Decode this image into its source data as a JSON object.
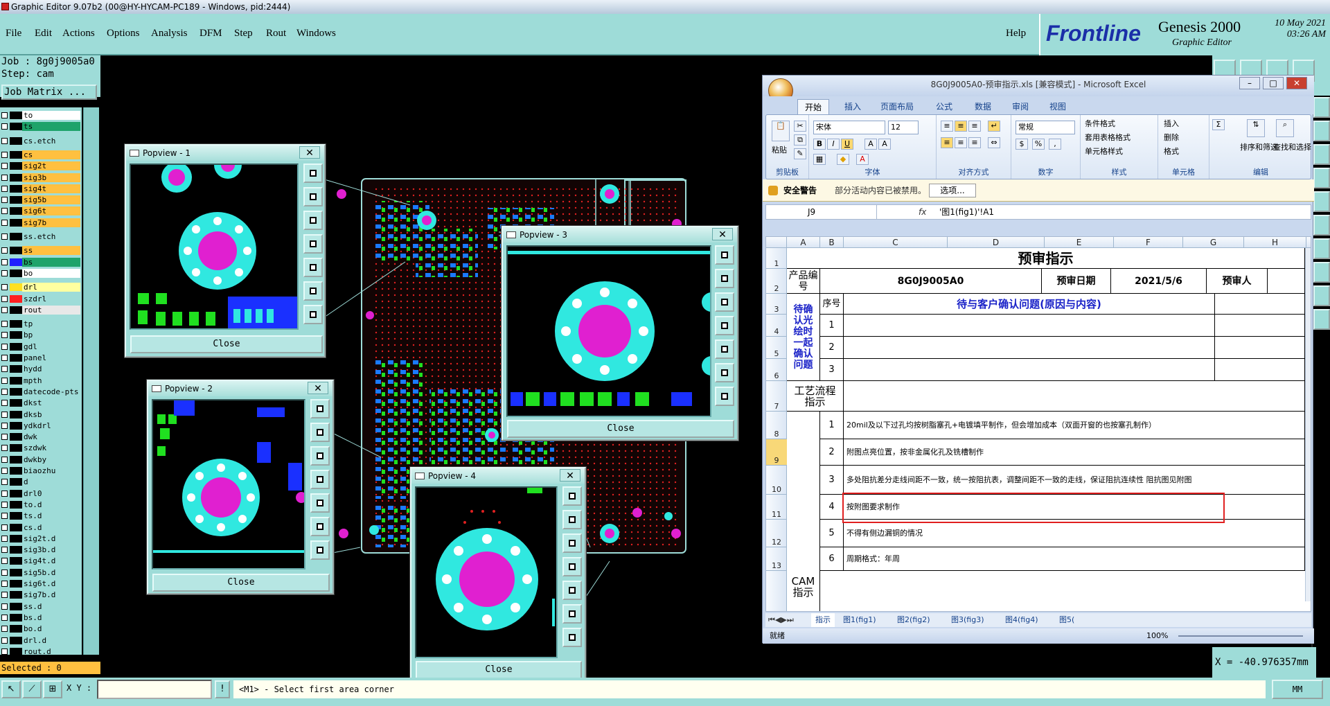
{
  "window": {
    "title": "Graphic Editor 9.07b2 (00@HY-HYCAM-PC189 - Windows, pid:2444)"
  },
  "menu": {
    "items": [
      "File",
      "Edit",
      "Actions",
      "Options",
      "Analysis",
      "DFM",
      "Step",
      "Rout",
      "Windows"
    ],
    "help": "Help"
  },
  "brand": {
    "logo": "Frontline",
    "product": "Genesis 2000",
    "subtitle": "Graphic Editor",
    "date": "10 May 2021",
    "time": "03:26 AM"
  },
  "job": {
    "job_line": "Job : 8g0j9005a0",
    "step_line": "Step: cam",
    "matrix_button": "Job Matrix ..."
  },
  "layers": [
    {
      "name": "to",
      "color": "#ffffff",
      "swatch": "#000000"
    },
    {
      "name": "ts",
      "color": "#1ea36a",
      "swatch": "#000000"
    },
    {
      "name": "cs.etch",
      "color": "#9edcd8",
      "swatch": "#000000"
    },
    {
      "name": "cs",
      "color": "#ffc040",
      "swatch": "#000000"
    },
    {
      "name": "sig2t",
      "color": "#ffc040",
      "swatch": "#000000"
    },
    {
      "name": "sig3b",
      "color": "#ffc040",
      "swatch": "#000000"
    },
    {
      "name": "sig4t",
      "color": "#ffc040",
      "swatch": "#000000"
    },
    {
      "name": "sig5b",
      "color": "#ffc040",
      "swatch": "#000000"
    },
    {
      "name": "sig6t",
      "color": "#ffc040",
      "swatch": "#000000"
    },
    {
      "name": "sig7b",
      "color": "#ffc040",
      "swatch": "#000000"
    },
    {
      "name": "ss.etch",
      "color": "#9edcd8",
      "swatch": "#000000"
    },
    {
      "name": "ss",
      "color": "#ffc040",
      "swatch": "#000000"
    },
    {
      "name": "bs",
      "color": "#1ea36a",
      "swatch": "#2020ff"
    },
    {
      "name": "bo",
      "color": "#ffffff",
      "swatch": "#000000"
    },
    {
      "name": "drl",
      "color": "#ffffa0",
      "swatch": "#ffe020"
    },
    {
      "name": "szdrl",
      "color": "#9edcd8",
      "swatch": "#ff2020"
    },
    {
      "name": "rout",
      "color": "#e8e8e8",
      "swatch": "#000000"
    },
    {
      "name": "tp",
      "color": "#9edcd8",
      "swatch": "#000000"
    },
    {
      "name": "bp",
      "color": "#9edcd8",
      "swatch": "#000000"
    },
    {
      "name": "gdl",
      "color": "#9edcd8",
      "swatch": "#000000"
    },
    {
      "name": "panel",
      "color": "#9edcd8",
      "swatch": "#000000"
    },
    {
      "name": "hydd",
      "color": "#9edcd8",
      "swatch": "#000000"
    },
    {
      "name": "mpth",
      "color": "#9edcd8",
      "swatch": "#000000"
    },
    {
      "name": "datecode-pts",
      "color": "#9edcd8",
      "swatch": "#000000"
    },
    {
      "name": "dkst",
      "color": "#9edcd8",
      "swatch": "#000000"
    },
    {
      "name": "dksb",
      "color": "#9edcd8",
      "swatch": "#000000"
    },
    {
      "name": "ydkdrl",
      "color": "#9edcd8",
      "swatch": "#000000"
    },
    {
      "name": "dwk",
      "color": "#9edcd8",
      "swatch": "#000000"
    },
    {
      "name": "szdwk",
      "color": "#9edcd8",
      "swatch": "#000000"
    },
    {
      "name": "dwkby",
      "color": "#9edcd8",
      "swatch": "#000000"
    },
    {
      "name": "biaozhu",
      "color": "#9edcd8",
      "swatch": "#000000"
    },
    {
      "name": "d",
      "color": "#9edcd8",
      "swatch": "#000000"
    },
    {
      "name": "drl0",
      "color": "#9edcd8",
      "swatch": "#000000"
    },
    {
      "name": "to.d",
      "color": "#9edcd8",
      "swatch": "#000000"
    },
    {
      "name": "ts.d",
      "color": "#9edcd8",
      "swatch": "#000000"
    },
    {
      "name": "cs.d",
      "color": "#9edcd8",
      "swatch": "#000000"
    },
    {
      "name": "sig2t.d",
      "color": "#9edcd8",
      "swatch": "#000000"
    },
    {
      "name": "sig3b.d",
      "color": "#9edcd8",
      "swatch": "#000000"
    },
    {
      "name": "sig4t.d",
      "color": "#9edcd8",
      "swatch": "#000000"
    },
    {
      "name": "sig5b.d",
      "color": "#9edcd8",
      "swatch": "#000000"
    },
    {
      "name": "sig6t.d",
      "color": "#9edcd8",
      "swatch": "#000000"
    },
    {
      "name": "sig7b.d",
      "color": "#9edcd8",
      "swatch": "#000000"
    },
    {
      "name": "ss.d",
      "color": "#9edcd8",
      "swatch": "#000000"
    },
    {
      "name": "bs.d",
      "color": "#9edcd8",
      "swatch": "#000000"
    },
    {
      "name": "bo.d",
      "color": "#9edcd8",
      "swatch": "#000000"
    },
    {
      "name": "drl.d",
      "color": "#9edcd8",
      "swatch": "#000000"
    },
    {
      "name": "rout.d",
      "color": "#9edcd8",
      "swatch": "#000000"
    }
  ],
  "selected": "Selected : 0",
  "coord": "X = -40.976357mm",
  "status": {
    "xy_label": "X Y :",
    "prompt": "<M1> - Select first area corner",
    "units": "MM"
  },
  "popviews": [
    {
      "title": "Popview - 1",
      "close": "Close"
    },
    {
      "title": "Popview - 2",
      "close": "Close"
    },
    {
      "title": "Popview - 3",
      "close": "Close"
    },
    {
      "title": "Popview - 4",
      "close": "Close"
    }
  ],
  "excel": {
    "title": "8G0J9005A0-预审指示.xls  [兼容模式]  - Microsoft Excel",
    "tabs": [
      "开始",
      "插入",
      "页面布局",
      "公式",
      "数据",
      "审阅",
      "视图"
    ],
    "ribbon": {
      "clipboard": "剪贴板",
      "paste": "粘贴",
      "font": "字体",
      "font_name": "宋体",
      "font_size": "12",
      "align": "对齐方式",
      "number": "数字",
      "number_fmt": "常规",
      "styles": "样式",
      "cond_fmt": "条件格式",
      "table_fmt": "套用表格格式",
      "cell_style": "单元格样式",
      "cells": "单元格",
      "insert": "插入",
      "delete": "删除",
      "format": "格式",
      "editing": "编辑",
      "sort": "排序和筛选",
      "find": "查找和选择"
    },
    "security": {
      "label": "安全警告",
      "message": "部分活动内容已被禁用。",
      "options": "选项..."
    },
    "namebox": "J9",
    "fx": "fx",
    "formula": "'图1(fig1)'!A1",
    "columns": [
      "A",
      "B",
      "C",
      "D",
      "E",
      "F",
      "G",
      "H"
    ],
    "rows": [
      "1",
      "2",
      "3",
      "4",
      "5",
      "6",
      "7",
      "8",
      "9",
      "10",
      "11",
      "12",
      "13"
    ],
    "sheet": {
      "title": "预审指示",
      "product_no_label": "产品编号",
      "product_no": "8G0J9005A0",
      "date_label": "预审日期",
      "date": "2021/5/6",
      "reviewer_label": "预审人",
      "seq_label": "序号",
      "issue_header": "待与客户确认问题(原因与内容)",
      "pending_label": "待确认光绘时一起确认问题",
      "process_label": "工艺流程指示",
      "cam_label": "CAM指示",
      "nums": [
        "1",
        "2",
        "3"
      ],
      "cam_nums": [
        "1",
        "2",
        "3",
        "4",
        "5",
        "6"
      ],
      "cam_items": [
        "20mil及以下过孔均按树脂塞孔+电镀填平制作，但会增加成本（双面开窗的也按塞孔制作）",
        "附图点亮位置，按非金属化孔及铣槽制作",
        "多处阻抗差分走线间距不一致，统一按阻抗表，调整间距不一致的走线，保证阻抗连续性   阻抗图见附图",
        "按附图要求制作",
        "不得有侧边漏铜的情况",
        "周期格式：年周"
      ]
    },
    "sheet_tabs": [
      "指示",
      "图1(fig1)",
      "图2(fig2)",
      "图3(fig3)",
      "图4(fig4)",
      "图5("
    ],
    "status": "就绪",
    "zoom": "100%"
  }
}
